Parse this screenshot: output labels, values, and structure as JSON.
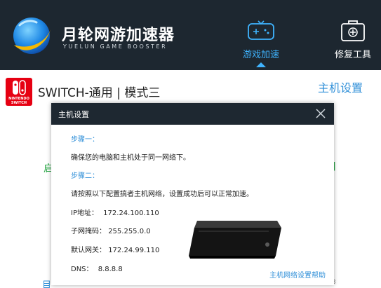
{
  "header": {
    "brand_cn": "月轮网游加速器",
    "brand_en": "YUELUN GAME BOOSTER",
    "nav": [
      {
        "label": "游戏加速",
        "icon": "gamepad-icon",
        "active": true
      },
      {
        "label": "修复工具",
        "icon": "toolbox-icon",
        "active": false
      }
    ]
  },
  "content": {
    "console_title": "SWITCH-通用 | 模式三",
    "host_settings_link": "主机设置",
    "switch_logo": "NINTENDO SWITCH",
    "bg_left": "启",
    "bg_right": "]",
    "bg_bottom_left": "目",
    "bg_bottom_right": "3"
  },
  "modal": {
    "title": "主机设置",
    "step1_label": "步骤一：",
    "step1_text": "确保您的电脑和主机处于同一网络下。",
    "step2_label": "步骤二：",
    "step2_text": "请按照以下配置搞者主机网络，设置成功后可以正常加速。",
    "ip_label": "IP地址：",
    "ip_value": "172.24.100.110",
    "mask_label": "子网掩码：",
    "mask_value": "255.255.0.0",
    "gateway_label": "默认网关：",
    "gateway_value": "172.24.99.110",
    "dns_label": "DNS：",
    "dns_value": "8.8.8.8",
    "help_link": "主机网络设置帮助"
  },
  "colors": {
    "header_bg": "#1d2730",
    "accent_blue": "#3fb4ff",
    "link_blue": "#2f8fd8",
    "switch_red": "#e60012",
    "green": "#28a745"
  }
}
